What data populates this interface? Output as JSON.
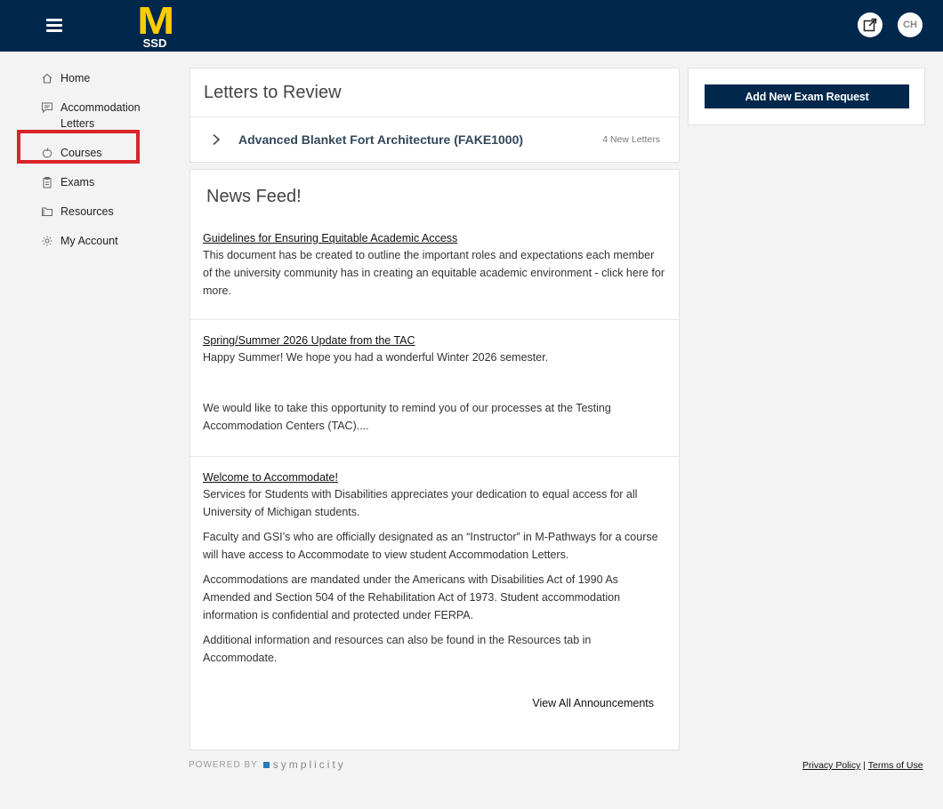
{
  "header": {
    "logo_letter": "M",
    "logo_sub": "SSD",
    "avatar_initials": "CH",
    "menu_icon": "hamburger-icon",
    "external_icon": "external-link-icon"
  },
  "sidebar": {
    "items": [
      {
        "label": "Home",
        "icon": "home-icon"
      },
      {
        "label": "Accommodation Letters",
        "icon": "message-icon"
      },
      {
        "label": "Courses",
        "icon": "apple-icon"
      },
      {
        "label": "Exams",
        "icon": "clipboard-icon"
      },
      {
        "label": "Resources",
        "icon": "folder-icon"
      },
      {
        "label": "My Account",
        "icon": "gear-icon"
      }
    ]
  },
  "letters": {
    "title": "Letters to Review",
    "rows": [
      {
        "course": "Advanced Blanket Fort Architecture (FAKE1000)",
        "count": "4 New Letters"
      }
    ]
  },
  "news": {
    "title": "News Feed!",
    "items": [
      {
        "headline": "Guidelines for Ensuring Equitable Academic Access",
        "paragraphs": [
          "This document has be created to outline the important roles and expectations each member of the university community has in creating an equitable academic environment - click here for more."
        ]
      },
      {
        "headline": "Spring/Summer 2026 Update from the TAC",
        "paragraphs": [
          "Happy Summer! We hope you had a wonderful Winter 2026 semester.",
          "We would like to take this opportunity to remind you of our processes at the Testing Accommodation Centers (TAC)...."
        ]
      },
      {
        "headline": "Welcome to Accommodate!",
        "paragraphs": [
          "Services for Students with Disabilities appreciates your dedication to equal access for all University of Michigan students.",
          "Faculty and GSI’s who are officially designated as an “Instructor” in M-Pathways for a course will have access to Accommodate to view student Accommodation Letters.",
          "Accommodations are mandated under the Americans with Disabilities Act of 1990 As Amended and Section 504 of the Rehabilitation Act of 1973. Student accommodation information is confidential and protected under FERPA.",
          "Additional information and resources can also be found in the Resources tab in Accommodate."
        ]
      }
    ],
    "view_all": "View All Announcements"
  },
  "side": {
    "exam_button": "Add New Exam Request"
  },
  "footer": {
    "powered_by": "POWERED BY",
    "brand": "symplicity",
    "privacy": "Privacy Policy",
    "separator": "|",
    "terms": "Terms of Use"
  },
  "colors": {
    "header_bg": "#00274c",
    "maize": "#ffcb05",
    "highlight": "#d9232a"
  }
}
